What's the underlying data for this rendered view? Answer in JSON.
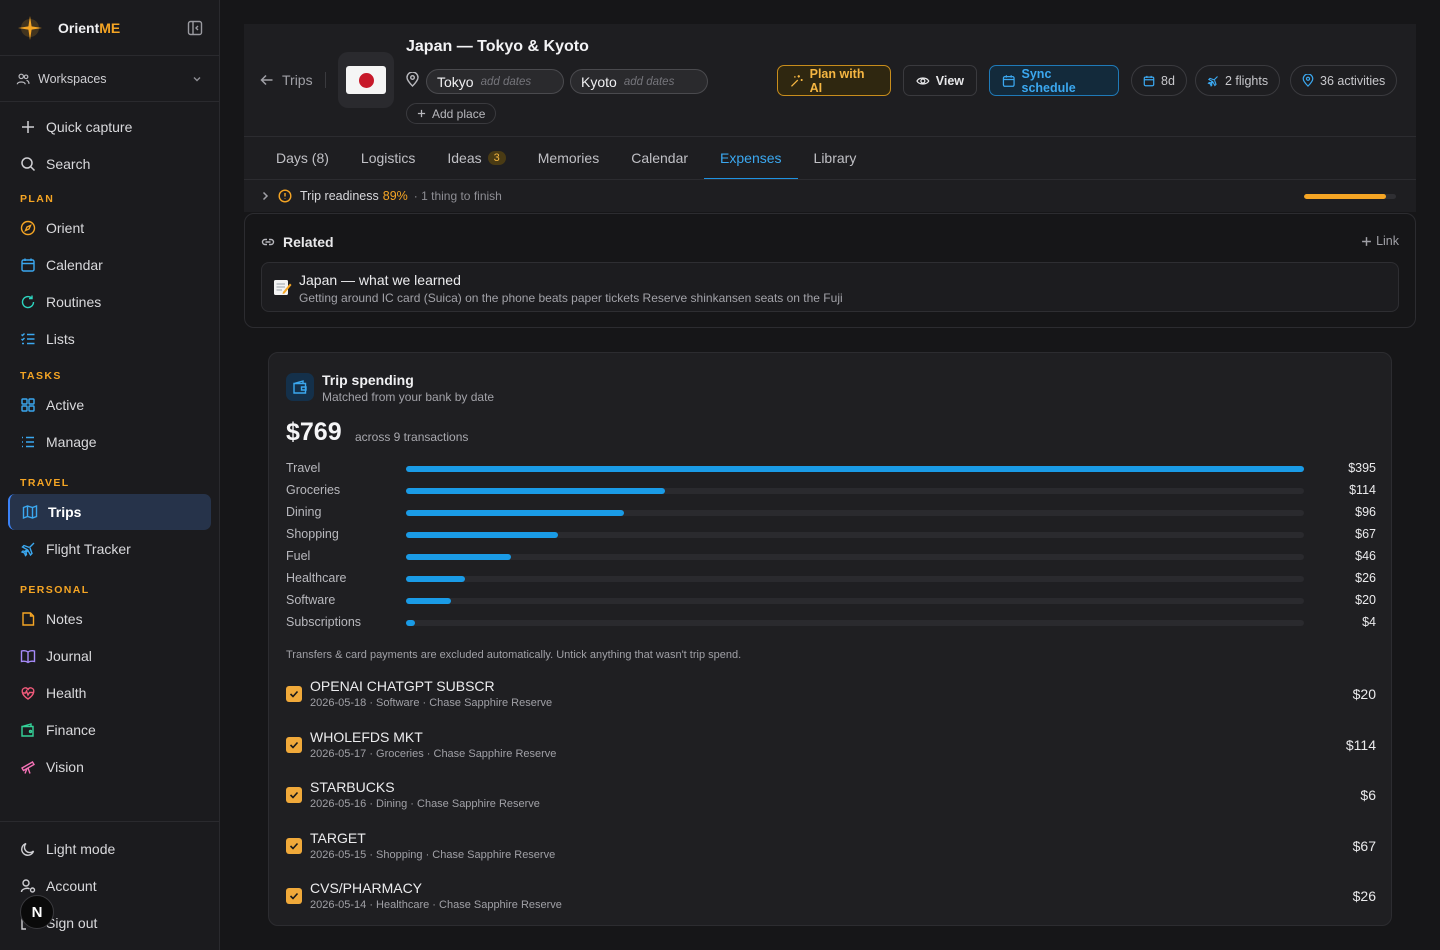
{
  "sidebar": {
    "brand": {
      "name_main": "Orient",
      "name_accent": "ME"
    },
    "workspaces": "Workspaces",
    "quick": [
      {
        "label": "Quick capture",
        "icon": "plus-icon"
      },
      {
        "label": "Search",
        "icon": "search-icon"
      }
    ],
    "sections": {
      "plan": "PLAN",
      "tasks": "TASKS",
      "travel": "TRAVEL",
      "personal": "PERSONAL"
    },
    "plan_items": [
      {
        "label": "Orient",
        "icon": "compass-icon"
      },
      {
        "label": "Calendar",
        "icon": "calendar-icon"
      },
      {
        "label": "Routines",
        "icon": "refresh-icon"
      },
      {
        "label": "Lists",
        "icon": "list-check-icon"
      }
    ],
    "task_items": [
      {
        "label": "Active",
        "icon": "grid-icon"
      },
      {
        "label": "Manage",
        "icon": "list-icon"
      }
    ],
    "travel_items": [
      {
        "label": "Trips",
        "icon": "map-icon",
        "active": true
      },
      {
        "label": "Flight Tracker",
        "icon": "plane-icon"
      }
    ],
    "personal_items": [
      {
        "label": "Notes",
        "icon": "note-icon"
      },
      {
        "label": "Journal",
        "icon": "book-icon"
      },
      {
        "label": "Health",
        "icon": "heart-pulse-icon"
      },
      {
        "label": "Finance",
        "icon": "wallet-icon"
      },
      {
        "label": "Vision",
        "icon": "telescope-icon"
      }
    ],
    "bottom_items": [
      {
        "label": "Light mode",
        "icon": "moon-icon"
      },
      {
        "label": "Account",
        "icon": "user-gear-icon"
      },
      {
        "label": "Sign out",
        "icon": "logout-icon"
      }
    ],
    "avatar": "N"
  },
  "header": {
    "back_label": "Trips",
    "title": "Japan — Tokyo & Kyoto",
    "places": [
      {
        "name": "Tokyo",
        "dates": "add dates"
      },
      {
        "name": "Kyoto",
        "dates": "add dates"
      }
    ],
    "add_place": "Add place",
    "buttons": {
      "plan_ai": "Plan with AI",
      "view": "View",
      "sync": "Sync schedule"
    },
    "pills": {
      "days": "8d",
      "flights": "2 flights",
      "activities": "36 activities"
    }
  },
  "tabs": [
    {
      "label": "Days (8)"
    },
    {
      "label": "Logistics"
    },
    {
      "label": "Ideas",
      "badge": "3"
    },
    {
      "label": "Memories"
    },
    {
      "label": "Calendar"
    },
    {
      "label": "Expenses",
      "active": true
    },
    {
      "label": "Library"
    }
  ],
  "readiness": {
    "label": "Trip readiness",
    "percent": "89%",
    "value": 0.89,
    "sub": "· 1 thing to finish"
  },
  "related": {
    "title": "Related",
    "link_label": "Link",
    "item": {
      "title": "Japan — what we learned",
      "snippet": "Getting around IC card (Suica) on the phone beats paper tickets Reserve shinkansen seats on the Fuji"
    }
  },
  "spending": {
    "title": "Trip spending",
    "subtitle": "Matched from your bank by date",
    "total": "$769",
    "total_sub": "across 9 transactions",
    "categories": [
      {
        "name": "Travel",
        "amount": "$395",
        "value": 395
      },
      {
        "name": "Groceries",
        "amount": "$114",
        "value": 114
      },
      {
        "name": "Dining",
        "amount": "$96",
        "value": 96
      },
      {
        "name": "Shopping",
        "amount": "$67",
        "value": 67
      },
      {
        "name": "Fuel",
        "amount": "$46",
        "value": 46
      },
      {
        "name": "Healthcare",
        "amount": "$26",
        "value": 26
      },
      {
        "name": "Software",
        "amount": "$20",
        "value": 20
      },
      {
        "name": "Subscriptions",
        "amount": "$4",
        "value": 4
      }
    ],
    "note": "Transfers & card payments are excluded automatically. Untick anything that wasn't trip spend.",
    "transactions": [
      {
        "name": "OPENAI CHATGPT SUBSCR",
        "meta": "2026-05-18 · Software · Chase Sapphire Reserve",
        "amount": "$20"
      },
      {
        "name": "WHOLEFDS MKT",
        "meta": "2026-05-17 · Groceries · Chase Sapphire Reserve",
        "amount": "$114"
      },
      {
        "name": "STARBUCKS",
        "meta": "2026-05-16 · Dining · Chase Sapphire Reserve",
        "amount": "$6"
      },
      {
        "name": "TARGET",
        "meta": "2026-05-15 · Shopping · Chase Sapphire Reserve",
        "amount": "$67"
      },
      {
        "name": "CVS/PHARMACY",
        "meta": "2026-05-14 · Healthcare · Chase Sapphire Reserve",
        "amount": "$26"
      }
    ]
  },
  "colors": {
    "accent": "#f5a524",
    "blue": "#1a9be6",
    "background": "#161618"
  }
}
